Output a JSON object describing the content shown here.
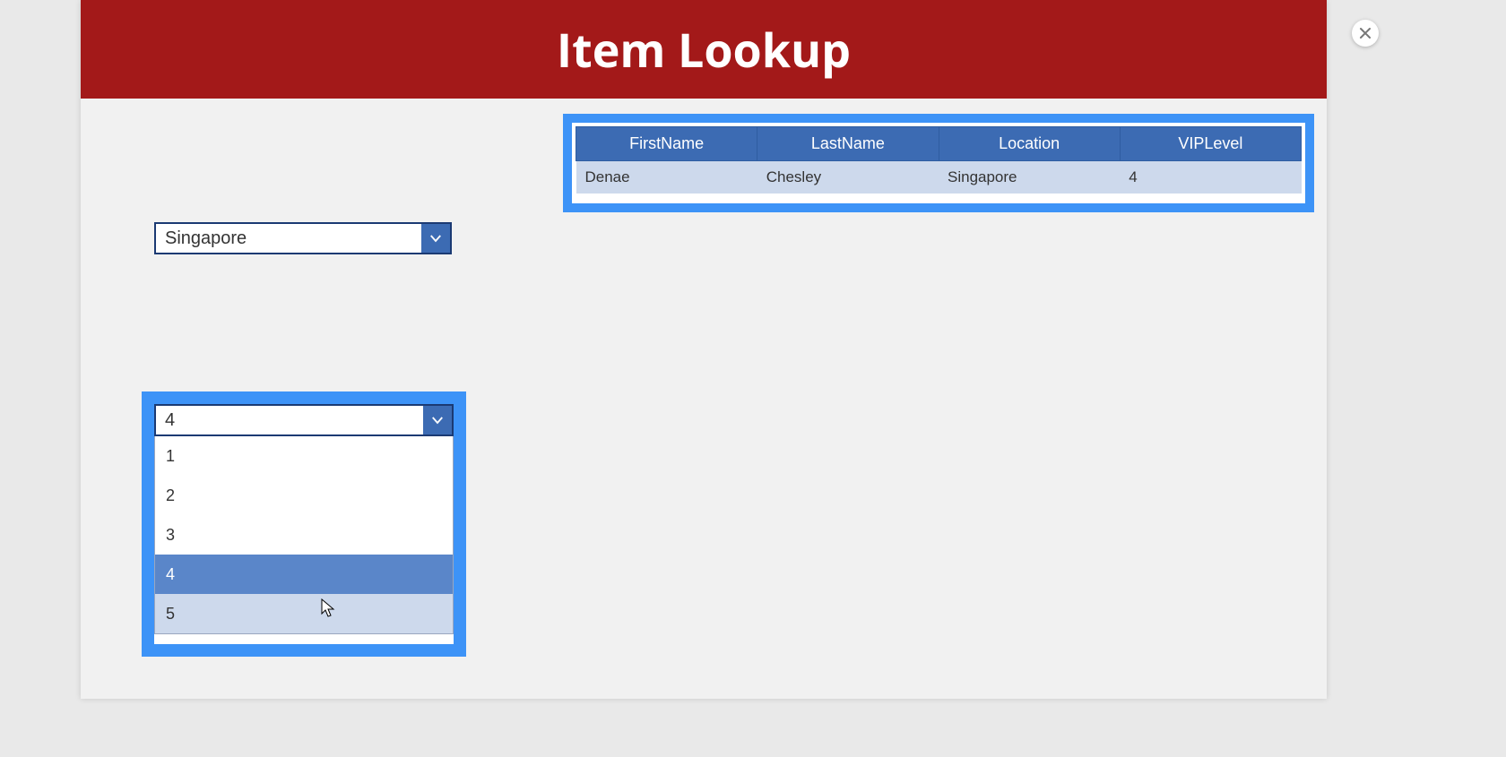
{
  "header": {
    "title": "Item Lookup"
  },
  "location_select": {
    "value": "Singapore"
  },
  "vip_select": {
    "value": "4",
    "options": [
      "1",
      "2",
      "3",
      "4",
      "5"
    ],
    "selected_index": 3,
    "hover_index": 4
  },
  "table": {
    "columns": [
      "FirstName",
      "LastName",
      "Location",
      "VIPLevel"
    ],
    "rows": [
      {
        "FirstName": "Denae",
        "LastName": "Chesley",
        "Location": "Singapore",
        "VIPLevel": "4"
      }
    ]
  },
  "colors": {
    "brand_red": "#a31919",
    "accent_blue": "#3c6bb3",
    "highlight_blue": "#3d93f7",
    "row_alt": "#cdd9ec"
  }
}
